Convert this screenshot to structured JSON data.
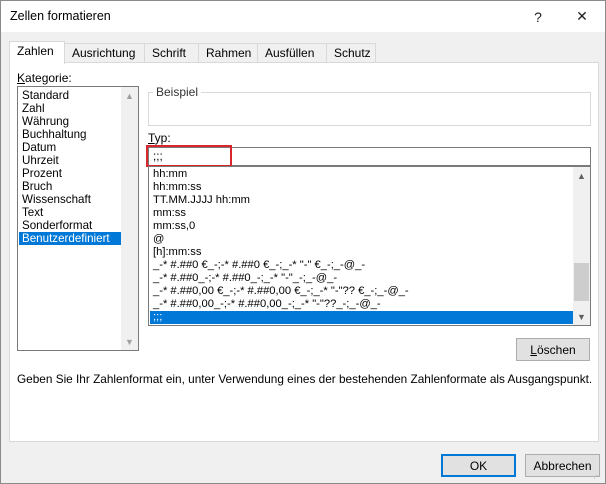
{
  "window": {
    "title": "Zellen formatieren",
    "help_glyph": "?",
    "close_glyph": "✕"
  },
  "tabs": [
    {
      "label": "Zahlen",
      "active": true
    },
    {
      "label": "Ausrichtung",
      "active": false
    },
    {
      "label": "Schrift",
      "active": false
    },
    {
      "label": "Rahmen",
      "active": false
    },
    {
      "label": "Ausfüllen",
      "active": false
    },
    {
      "label": "Schutz",
      "active": false
    }
  ],
  "category": {
    "label_accel": "K",
    "label_rest": "ategorie:",
    "items": [
      "Standard",
      "Zahl",
      "Währung",
      "Buchhaltung",
      "Datum",
      "Uhrzeit",
      "Prozent",
      "Bruch",
      "Wissenschaft",
      "Text",
      "Sonderformat",
      "Benutzerdefiniert"
    ],
    "selected_index": 11
  },
  "beispiel": {
    "label": "Beispiel"
  },
  "type": {
    "label_accel": "T",
    "label_rest": "yp:",
    "value": ";;;"
  },
  "formats": {
    "items": [
      "hh:mm",
      "hh:mm:ss",
      "TT.MM.JJJJ hh:mm",
      "mm:ss",
      "mm:ss,0",
      "@",
      "[h]:mm:ss",
      "_-* #.##0 €_-;-* #.##0 €_-;_-* \"-\" €_-;_-@_-",
      "_-* #.##0_-;-* #.##0_-;_-* \"-\"_-;_-@_-",
      "_-* #.##0,00 €_-;-* #.##0,00 €_-;_-* \"-\"?? €_-;_-@_-",
      "_-* #.##0,00_-;-* #.##0,00_-;_-* \"-\"??_-;_-@_-",
      ";;;"
    ],
    "selected_index": 11
  },
  "buttons": {
    "delete": "Löschen",
    "delete_accel": "L",
    "ok": "OK",
    "cancel": "Abbrechen"
  },
  "description": "Geben Sie Ihr Zahlenformat ein, unter Verwendung eines der bestehenden Zahlenformate als Ausgangspunkt.",
  "icons": {
    "up": "▲",
    "down": "▼"
  },
  "colors": {
    "selection": "#0078d7",
    "highlight_box": "#d9262c"
  }
}
